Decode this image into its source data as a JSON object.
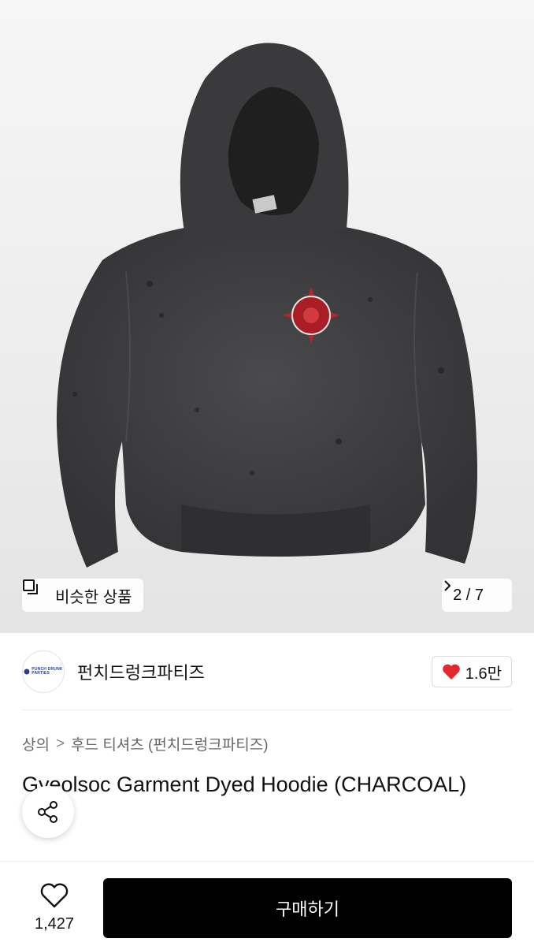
{
  "gallery": {
    "similar_label": "비슷한 상품",
    "pager_label": "2 / 7"
  },
  "brand": {
    "name": "펀치드렁크파티즈",
    "logo_text_line1": "PUNCH DRUNK",
    "logo_text_line2": "PARTIES",
    "likes": "1.6만"
  },
  "breadcrumb": {
    "level1": "상의",
    "separator": ">",
    "level2": "후드 티셔츠 (펀치드렁크파티즈)"
  },
  "product": {
    "title": "Gyeolsoc Garment Dyed Hoodie (CHARCOAL)"
  },
  "bottom_bar": {
    "wish_count": "1,427",
    "buy_label": "구매하기"
  },
  "colors": {
    "accent_red": "#e0282e",
    "buy_button": "#000000",
    "hoodie": "#3d3d3f"
  },
  "icons": {
    "similar": "copy-icon",
    "pager": "chevron-right-icon",
    "likes": "heart-filled-icon",
    "share": "share-icon",
    "wish": "heart-outline-icon"
  }
}
